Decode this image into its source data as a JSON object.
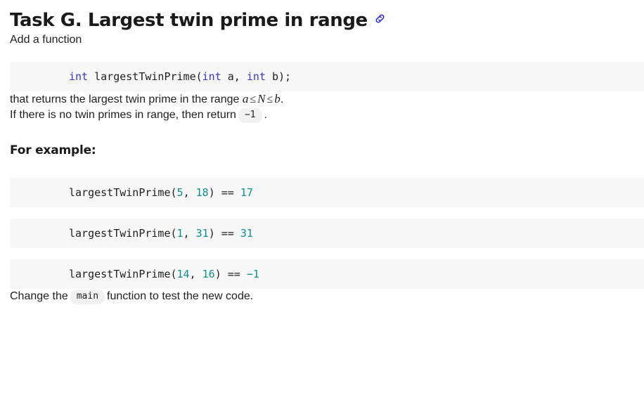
{
  "heading": {
    "title": "Task G. Largest twin prime in range",
    "anchor_icon": "link-icon"
  },
  "intro": {
    "add_function": "Add a function"
  },
  "signature": {
    "kw1": "int",
    "space1": " ",
    "fn_name": "largestTwinPrime",
    "paren_open": "(",
    "kw2": "int",
    "param_a": " a,",
    "kw3": "int",
    "param_b": " b",
    "paren_close": ");"
  },
  "description": {
    "returns_prefix": "that returns the largest twin prime in the range ",
    "var_a": "a",
    "rel1": "≤",
    "var_n": "N",
    "rel2": "≤",
    "var_b": "b",
    "period": ".",
    "no_twin_prefix": "If there is no twin primes in range, then return",
    "no_twin_code": "−1",
    "no_twin_suffix": "."
  },
  "examples": {
    "subtitle": "For example:",
    "items": [
      {
        "fn_name": "largestTwinPrime",
        "paren_open": "(",
        "arg1": "5",
        "comma": ", ",
        "arg2": "18",
        "paren_close": ")",
        "operator": " == ",
        "result": "17"
      },
      {
        "fn_name": "largestTwinPrime",
        "paren_open": "(",
        "arg1": "1",
        "comma": ", ",
        "arg2": "31",
        "paren_close": ")",
        "operator": " == ",
        "result": "31"
      },
      {
        "fn_name": "largestTwinPrime",
        "paren_open": "(",
        "arg1": "14",
        "comma": ", ",
        "arg2": "16",
        "paren_close": ")",
        "operator": " == ",
        "result": "−1"
      }
    ]
  },
  "closing": {
    "prefix": "Change the",
    "code": "main",
    "suffix": "function to test the new code."
  },
  "colors": {
    "keyword": "#3a37c9",
    "number": "#0d8f8f",
    "anchor": "#2222dd",
    "code_bg": "#f7f7f7",
    "inline_code_bg": "#f2f2f2",
    "heading": "#1a1a1a",
    "body": "#222222"
  }
}
